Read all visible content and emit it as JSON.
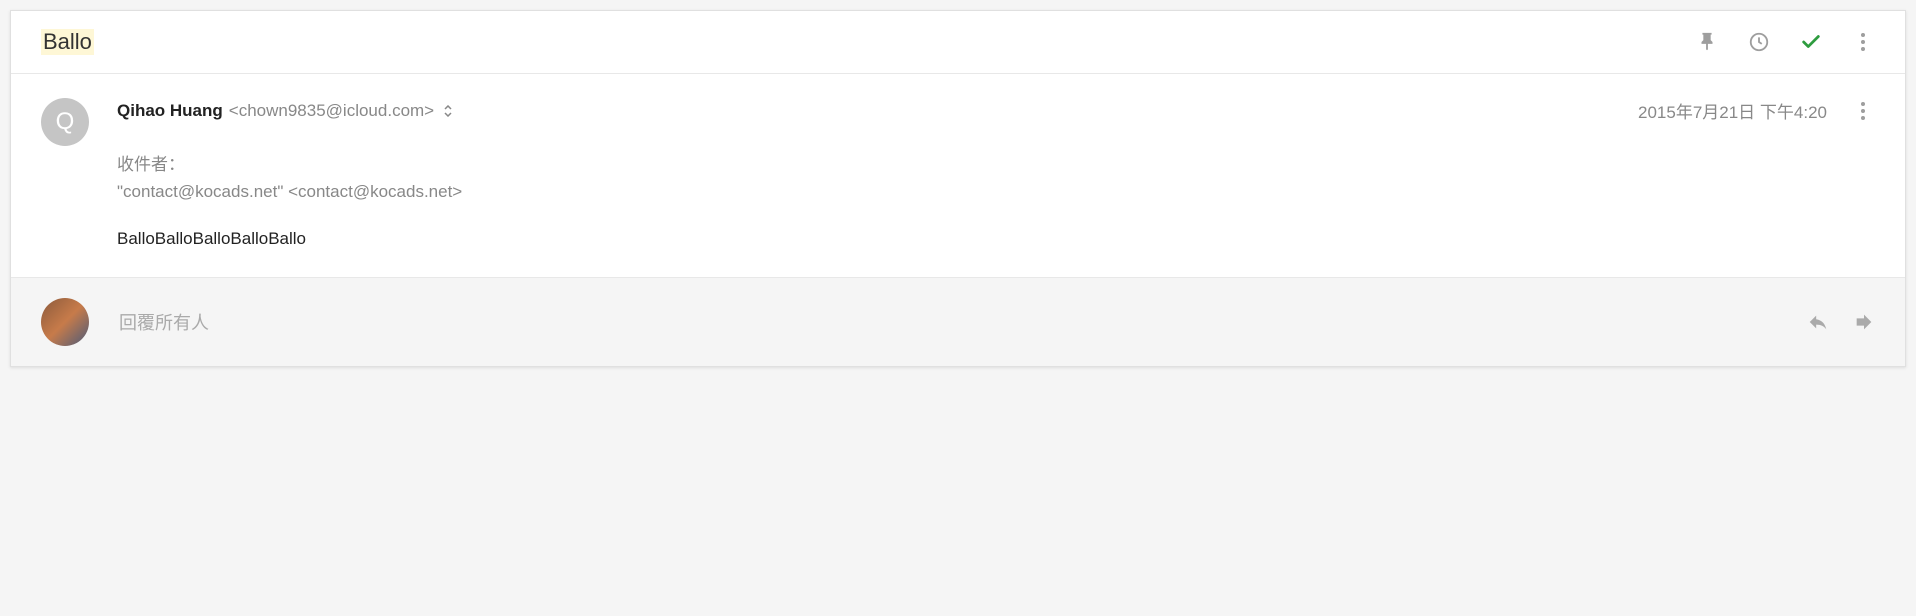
{
  "subject": "Ballo",
  "sender": {
    "name": "Qihao Huang",
    "email": "<chown9835@icloud.com>",
    "avatar_letter": "Q"
  },
  "date": "2015年7月21日 下午4:20",
  "recipients": {
    "label": "收件者：",
    "value": "\"contact@kocads.net\" <contact@kocads.net>"
  },
  "message_body": "BalloBalloBalloBalloBallo",
  "reply": {
    "placeholder": "回覆所有人"
  }
}
